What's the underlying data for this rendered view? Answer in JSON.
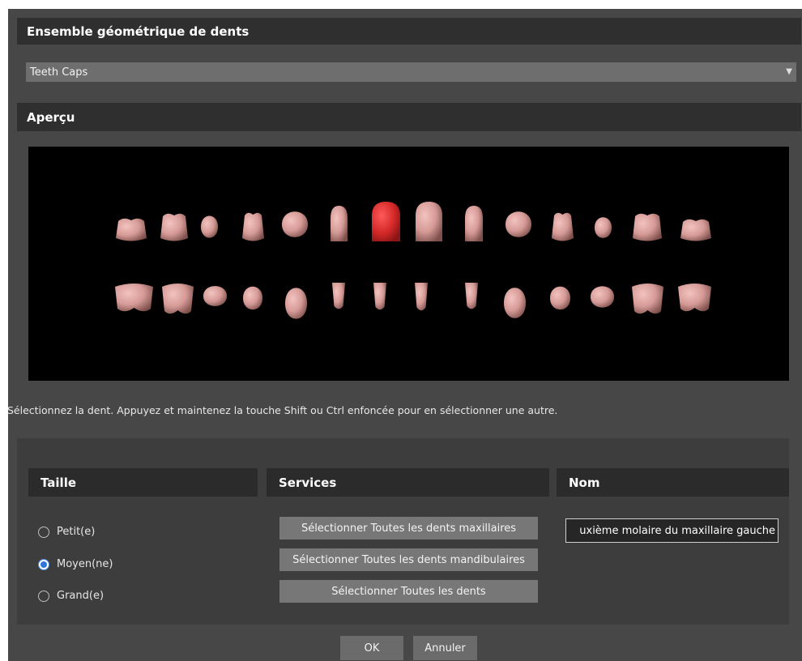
{
  "geometry_section": {
    "title": "Ensemble géométrique de dents",
    "dropdown_value": "Teeth Caps"
  },
  "preview_section": {
    "title": "Aperçu",
    "tooth_color": "#d59a96",
    "selected_tooth_color": "#d42828",
    "hint": "Sélectionnez la dent. Appuyez et maintenez la touche Shift ou Ctrl enfoncée pour en sélectionner une autre."
  },
  "size_section": {
    "title": "Taille",
    "options": [
      {
        "label": "Petit(e)",
        "selected": false
      },
      {
        "label": "Moyen(ne)",
        "selected": true
      },
      {
        "label": "Grand(e)",
        "selected": false
      }
    ]
  },
  "services_section": {
    "title": "Services",
    "buttons": [
      "Sélectionner Toutes les dents maxillaires",
      "Sélectionner Toutes les dents mandibulaires",
      "Sélectionner Toutes les dents"
    ]
  },
  "name_section": {
    "title": "Nom",
    "value": "uxième molaire du maxillaire gauche"
  },
  "footer": {
    "ok": "OK",
    "cancel": "Annuler"
  }
}
